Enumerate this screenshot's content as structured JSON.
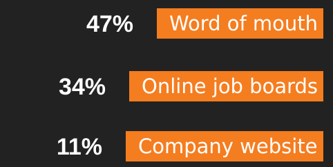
{
  "chart_data": {
    "type": "bar",
    "orientation": "horizontal",
    "categories": [
      "Word of mouth",
      "Online job boards",
      "Company website"
    ],
    "values": [
      47,
      34,
      11
    ],
    "value_labels": [
      "47%",
      "34%",
      "11%"
    ],
    "unit": "%",
    "title": "",
    "xlabel": "",
    "ylabel": "",
    "grid": false,
    "legend": "none"
  },
  "colors": {
    "background": "#222222",
    "bar": "#f47d20",
    "text": "#ffffff"
  }
}
